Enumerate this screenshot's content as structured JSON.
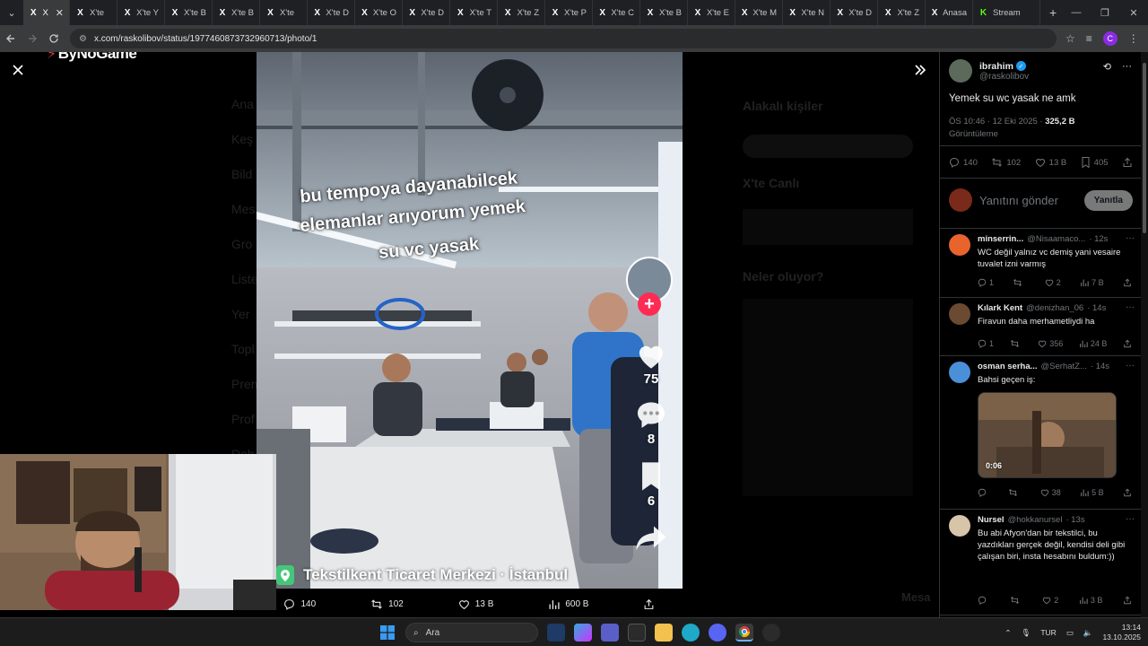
{
  "browser": {
    "tabs": [
      {
        "label": "X",
        "favicon": "X",
        "active": true
      },
      {
        "label": "X'te ",
        "favicon": "X"
      },
      {
        "label": "X'te Y",
        "favicon": "X"
      },
      {
        "label": "X'te B",
        "favicon": "X"
      },
      {
        "label": "X'te B",
        "favicon": "X"
      },
      {
        "label": "X'te ",
        "favicon": "X"
      },
      {
        "label": "X'te D",
        "favicon": "X"
      },
      {
        "label": "X'te O",
        "favicon": "X"
      },
      {
        "label": "X'te D",
        "favicon": "X"
      },
      {
        "label": "X'te T",
        "favicon": "X"
      },
      {
        "label": "X'te Z",
        "favicon": "X"
      },
      {
        "label": "X'te P",
        "favicon": "X"
      },
      {
        "label": "X'te C",
        "favicon": "X"
      },
      {
        "label": "X'te B",
        "favicon": "X"
      },
      {
        "label": "X'te E",
        "favicon": "X"
      },
      {
        "label": "X'te M",
        "favicon": "X"
      },
      {
        "label": "X'te N",
        "favicon": "X"
      },
      {
        "label": "X'te D",
        "favicon": "X"
      },
      {
        "label": "X'te Z",
        "favicon": "X"
      },
      {
        "label": "Anasa",
        "favicon": "X"
      },
      {
        "label": "Stream",
        "favicon": "K",
        "favicon_color": "#53fc18"
      }
    ],
    "new_tab": "+",
    "url": "x.com/raskolibov/status/1977460873732960713/photo/1"
  },
  "overlay": {
    "watermark": "ByNoGame",
    "photo_captions": [
      "bu tempoya dayanabilcek",
      "elemanlar arıyorum yemek",
      "su vc yasak"
    ],
    "tiktok": {
      "likes": "75",
      "comments": "8",
      "saves": "6"
    },
    "location": "Tekstilkent Ticaret Merkezi · İstanbul",
    "photo_actions": {
      "replies": "140",
      "reposts": "102",
      "likes": "13 B",
      "views": "600 B"
    }
  },
  "background_ghost": {
    "nav": [
      "Ana",
      "Keş",
      "Bild",
      "Mes",
      "Gro",
      "Liste",
      "Yer",
      "Topl",
      "Prem",
      "Prof",
      "Dah"
    ],
    "right": [
      "Alakalı kişiler",
      "X'te Canlı",
      "Neler oluyor?"
    ],
    "bottom_label": "Mesa"
  },
  "tweet": {
    "author": {
      "name": "ibrahim",
      "handle": "@raskolibov"
    },
    "text": "Yemek su wc yasak ne amk",
    "time": "ÖS 10:46 · 12 Eki 2025 · ",
    "views_count": "325,2 B",
    "views_label": "Görüntüleme",
    "stats": {
      "replies": "140",
      "reposts": "102",
      "likes": "13 B",
      "bookmarks": "405"
    },
    "reply_placeholder": "Yanıtını gönder",
    "reply_button": "Yanıtla"
  },
  "replies": [
    {
      "name": "minserrin...",
      "handle": "@Nisaamaco...",
      "time": "· 12s",
      "text": "WC değil yalnız vc demiş yani vesaire tuvalet izni varmış",
      "replies": "1",
      "reposts": "",
      "likes": "2",
      "views": "7 B",
      "avatar_color": "#e8642c"
    },
    {
      "name": "Kılark Kent",
      "handle": "@denizhan_06",
      "time": "· 14s",
      "text": "Firavun daha merhametliydi ha",
      "replies": "1",
      "reposts": "",
      "likes": "356",
      "views": "24 B",
      "avatar_color": "#6b4a32"
    },
    {
      "name": "osman serha...",
      "handle": "@SerhatZ...",
      "time": "· 14s",
      "text": "Bahsi geçen iş:",
      "replies": "",
      "reposts": "",
      "likes": "38",
      "views": "5 B",
      "video_time": "0:06",
      "avatar_color": "#4a90d9"
    },
    {
      "name": "Nursel",
      "handle": "@hokkanursel",
      "time": "· 13s",
      "text": "Bu abi Afyon'dan bir tekstilci, bu yazdıkları gerçek değil, kendisi deli gibi çalışan biri, insta hesabını buldum:))",
      "replies": "",
      "reposts": "",
      "likes": "2",
      "views": "3 B",
      "avatar_color": "#d8c4a8"
    }
  ],
  "taskbar": {
    "search_placeholder": "Ara",
    "language": "TUR",
    "time": "13:14",
    "date": "13.10.2025"
  }
}
